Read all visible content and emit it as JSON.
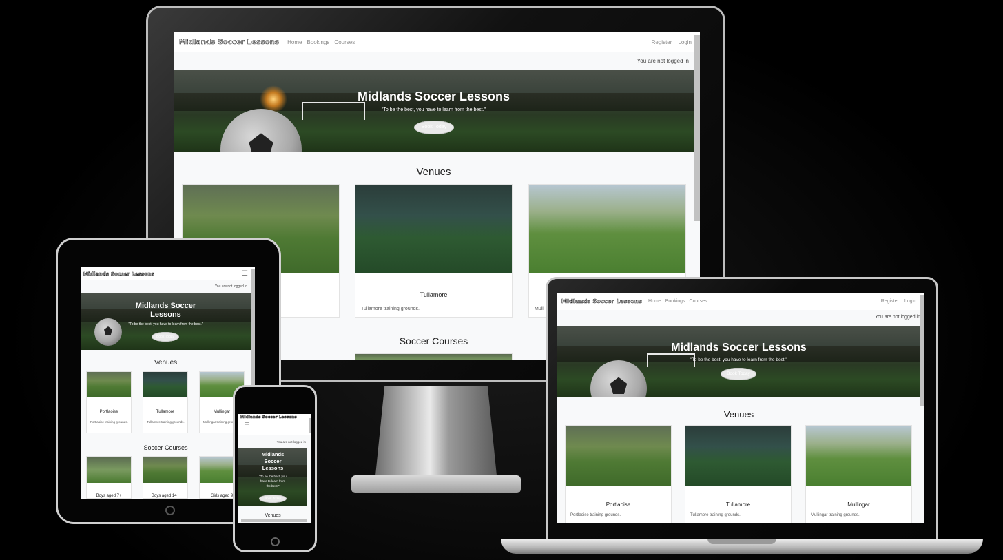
{
  "site": {
    "brand": "Midlands Soccer Lessons",
    "nav": {
      "home": "Home",
      "bookings": "Bookings",
      "courses": "Courses",
      "register": "Register",
      "login": "Login"
    },
    "status": "You are not logged in",
    "hero": {
      "title": "Midlands Soccer Lessons",
      "quote": "\"To be the best, you have to learn from the best.\"",
      "button": "Book Today"
    },
    "venues_heading": "Venues",
    "courses_heading": "Soccer Courses",
    "venues": [
      {
        "name": "Portlaoise",
        "desc": "Portlaoise training grounds."
      },
      {
        "name": "Tullamore",
        "desc": "Tullamore training grounds."
      },
      {
        "name": "Mullingar",
        "desc": "Mullingar training grounds."
      }
    ],
    "tablet_venue_desc": [
      "Portlaoise training grounds.",
      "Tullamore training grounds.",
      "Mullingar training grounds."
    ],
    "tablet_third_venue": "Mullingar",
    "monitor_third_desc": "Mulli",
    "courses": [
      {
        "name": "Boys aged 7+"
      },
      {
        "name": "Boys aged 14+"
      },
      {
        "name": "Girls aged 9"
      }
    ],
    "phone_title_lines": [
      "Midlands",
      "Soccer",
      "Lessons"
    ],
    "phone_quote_lines": [
      "\"To be the best, you",
      "have to learn from",
      "the best.\""
    ],
    "tablet_title_lines": [
      "Midlands Soccer",
      "Lessons"
    ],
    "hamburger_icon": "menu-icon"
  }
}
